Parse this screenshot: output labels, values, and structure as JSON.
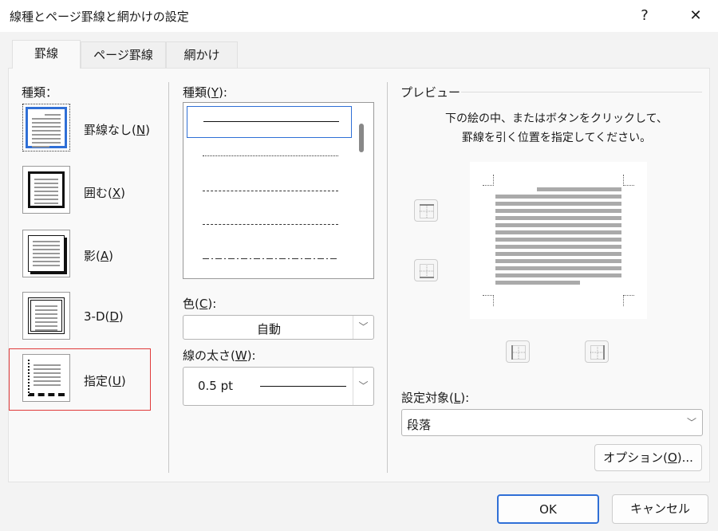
{
  "title": "線種とページ罫線と網かけの設定",
  "help_icon": "?",
  "close_icon": "✕",
  "tabs": [
    "罫線",
    "ページ罫線",
    "網かけ"
  ],
  "left": {
    "heading": "種類：",
    "items": [
      {
        "label": "罫線なし(",
        "key": "N",
        "end": ")"
      },
      {
        "label": "囲む(",
        "key": "X",
        "end": ")"
      },
      {
        "label": "影(",
        "key": "A",
        "end": ")"
      },
      {
        "label": "3-D(",
        "key": "D",
        "end": ")"
      },
      {
        "label": "指定(",
        "key": "U",
        "end": ")"
      }
    ]
  },
  "middle": {
    "style_label": "種類(",
    "style_key": "Y",
    "style_end": "):",
    "color_label": "色(",
    "color_key": "C",
    "color_end": "):",
    "color_value": "自動",
    "width_label": "線の太さ(",
    "width_key": "W",
    "width_end": "):",
    "width_value": "0.5 pt"
  },
  "preview": {
    "heading": "プレビュー",
    "instruction1": "下の絵の中、またはボタンをクリックして、",
    "instruction2": "罫線を引く位置を指定してください。",
    "apply_label": "設定対象(",
    "apply_key": "L",
    "apply_end": "):",
    "apply_value": "段落",
    "options_label": "オプション(",
    "options_key": "O",
    "options_end": ")..."
  },
  "footer": {
    "ok": "OK",
    "cancel": "キャンセル"
  },
  "colors": {
    "selected_outline": "#e03a3a",
    "accent": "#2f6fd6"
  }
}
